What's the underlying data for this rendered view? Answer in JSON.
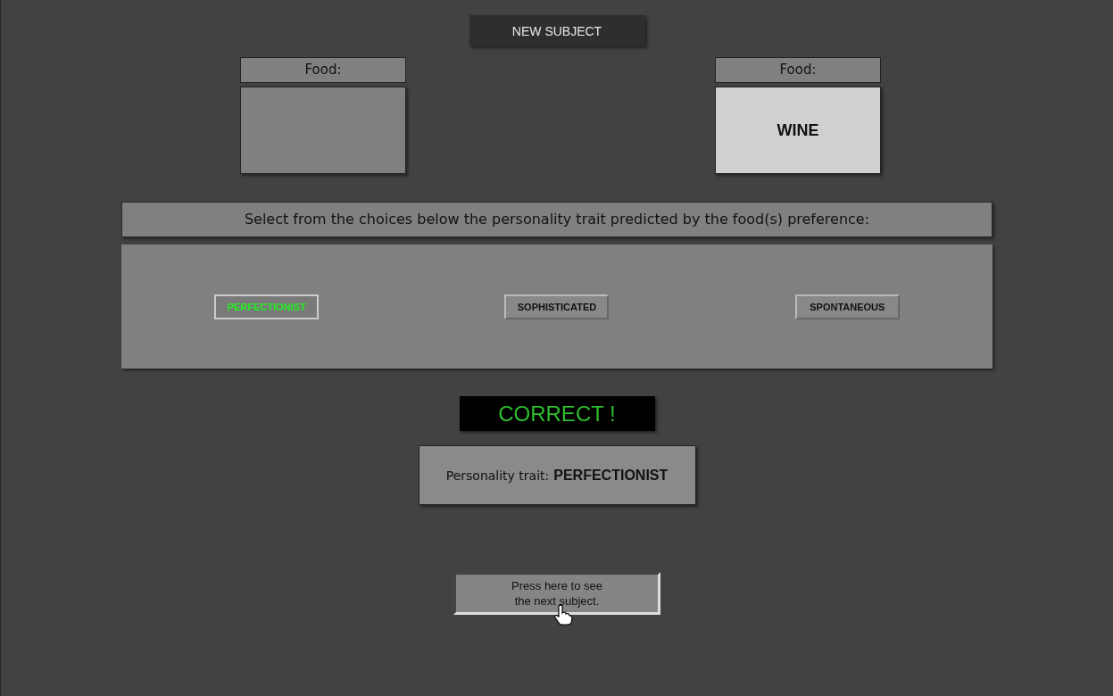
{
  "new_subject_button": "NEW SUBJECT",
  "foods": [
    {
      "label": "Food:",
      "filled": false
    },
    {
      "label": "Food:",
      "filled": true,
      "value": "WINE"
    }
  ],
  "prompt": "Select from the choices below the personality trait predicted by the food(s) preference:",
  "choices": [
    {
      "label": "PERFECTIONIST",
      "selected": true
    },
    {
      "label": "SOPHISTICATED",
      "selected": false
    },
    {
      "label": "SPONTANEOUS",
      "selected": false
    }
  ],
  "result": {
    "text": "CORRECT !",
    "correct": true
  },
  "trait": {
    "label": "Personality trait:",
    "value": "PERFECTIONIST"
  },
  "next_button": {
    "line_1": "Press here to see",
    "line_2": "the next subject."
  }
}
